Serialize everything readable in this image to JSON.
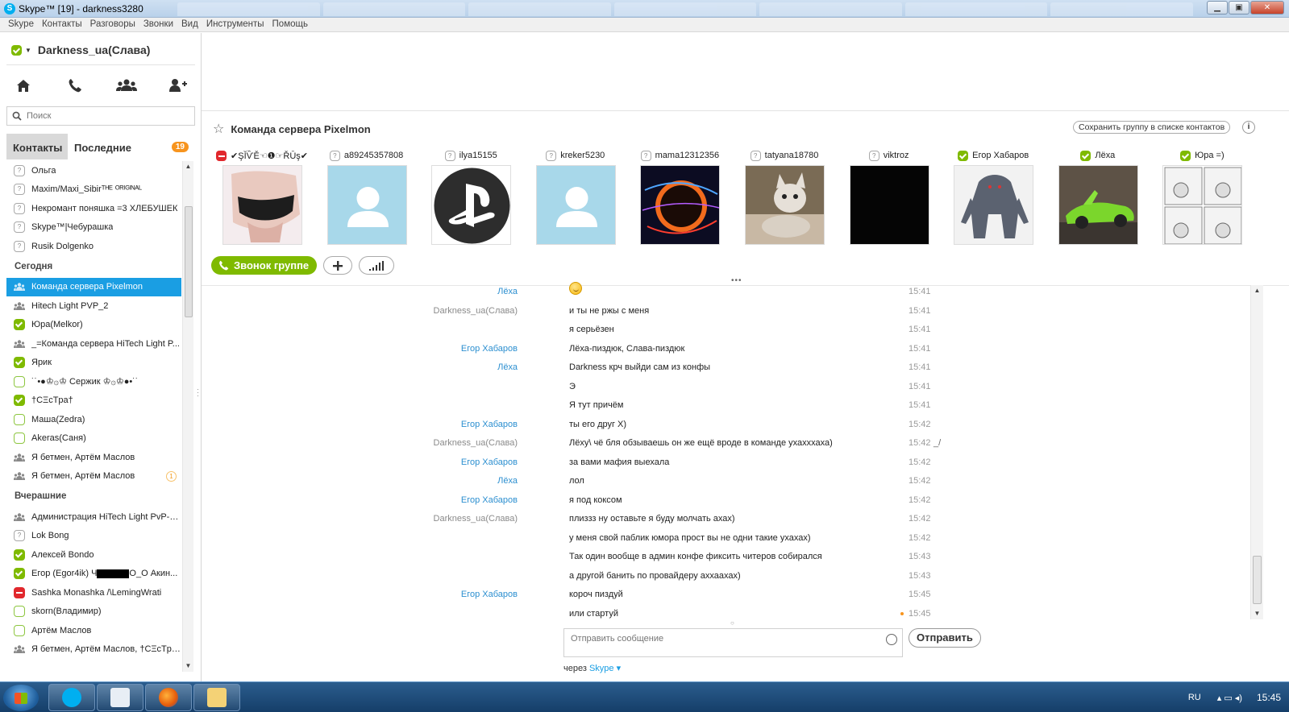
{
  "window": {
    "title": "Skype™ [19] - darkness3280",
    "minimize": "▁",
    "maximize": "▣",
    "close": "✕"
  },
  "menu": [
    "Skype",
    "Контакты",
    "Разговоры",
    "Звонки",
    "Вид",
    "Инструменты",
    "Помощь"
  ],
  "profile": {
    "name": "Darkness_ua(Слава)",
    "status": "online"
  },
  "nav_icons": [
    "home-icon",
    "phone-icon",
    "contacts-icon",
    "add-contact-icon"
  ],
  "search": {
    "placeholder": "Поиск",
    "value": ""
  },
  "tabs": {
    "contacts": "Контакты",
    "recent": "Последние",
    "recent_badge": "19"
  },
  "contacts_top": [
    {
      "name": "Ольга",
      "status": "unknown"
    },
    {
      "name": "Maxim/Maxi_Sibirᵀᴴᴱ ᴼᴿᴵᴳᴵᴺᴬᴸ",
      "status": "unknown"
    },
    {
      "name": "Некромант поняшка =3 ХЛЕБУШЕК",
      "status": "unknown"
    },
    {
      "name": "Skype™|Чебурашка",
      "status": "unknown"
    },
    {
      "name": "Rusik Dolgenko",
      "status": "unknown"
    }
  ],
  "section_today": "Сегодня",
  "contacts_today": [
    {
      "name": "Команда сервера Pixelmon",
      "status": "group",
      "selected": true
    },
    {
      "name": "Hitech Light PVP_2",
      "status": "group"
    },
    {
      "name": "Юра(Melkor)",
      "status": "online"
    },
    {
      "name": "_=Команда сервера HiTech Light P...",
      "status": "group"
    },
    {
      "name": "Ярик",
      "status": "online"
    },
    {
      "name": "˙˙•●♔۞♔ Сержик ♔۞♔●•˙˙",
      "status": "offline"
    },
    {
      "name": "†CΞcTpa†",
      "status": "online"
    },
    {
      "name": "Маша(Zedra)",
      "status": "offline"
    },
    {
      "name": "Akeras(Саня)",
      "status": "offline"
    },
    {
      "name": "Я бетмен, Артём Маслов",
      "status": "group"
    },
    {
      "name": "Я бетмен, Артём Маслов",
      "status": "group",
      "badge": "1"
    }
  ],
  "section_yesterday": "Вчерашние",
  "contacts_yesterday": [
    {
      "name": "Администрация HiTech Light PvP-P...",
      "status": "group"
    },
    {
      "name": "Lok Bong",
      "status": "unknown"
    },
    {
      "name": "Алексей Bondo",
      "status": "online"
    },
    {
      "name": "Егор  (Egor4ik) Ч",
      "suffix": "O_O Акин...",
      "status": "online",
      "redacted": true
    },
    {
      "name": "Sashka Monashka /\\LemingWrati",
      "status": "dnd"
    },
    {
      "name": "skorn(Владимир)",
      "status": "offline"
    },
    {
      "name": "Артём Маслов",
      "status": "offline"
    },
    {
      "name": "Я бетмен, Артём Маслов, †CΞcTpa†",
      "status": "group"
    }
  ],
  "chat": {
    "title": "Команда сервера Pixelmon",
    "save_group": "Сохранить группу в списке контактов",
    "info": "i",
    "call_group": "Звонок группе"
  },
  "members": [
    {
      "name": "✔ŞĬѶĚ☜❶☞ŘŪş✔",
      "status": "dnd",
      "avatar": "photo-pink"
    },
    {
      "name": "a89245357808",
      "status": "unknown",
      "avatar": "default"
    },
    {
      "name": "ilya15155",
      "status": "unknown",
      "avatar": "playstation"
    },
    {
      "name": "kreker5230",
      "status": "unknown",
      "avatar": "default"
    },
    {
      "name": "mama12312356",
      "status": "unknown",
      "avatar": "planet"
    },
    {
      "name": "tatyana18780",
      "status": "unknown",
      "avatar": "cat"
    },
    {
      "name": "viktroz",
      "status": "unknown",
      "avatar": "black"
    },
    {
      "name": "Егор Хабаров",
      "status": "online",
      "avatar": "monster"
    },
    {
      "name": "Лёха",
      "status": "online",
      "avatar": "car"
    },
    {
      "name": "Юра =)",
      "status": "online",
      "avatar": "comic"
    }
  ],
  "messages": [
    {
      "who": "Лёха",
      "color": "blue",
      "text": "",
      "smiley": true,
      "time": "15:41"
    },
    {
      "who": "Darkness_ua(Слава)",
      "color": "gray",
      "text": "и ты не ржы с меня",
      "time": "15:41"
    },
    {
      "who": "",
      "color": "gray",
      "text": "я серьёзен",
      "time": "15:41"
    },
    {
      "who": "Егор Хабаров",
      "color": "blue",
      "text": "Лёха-пиздюк, Слава-пиздюк",
      "time": "15:41"
    },
    {
      "who": "Лёха",
      "color": "blue",
      "text": "Darkness крч выйди сам из конфы",
      "time": "15:41"
    },
    {
      "who": "",
      "color": "blue",
      "text": "Э",
      "time": "15:41"
    },
    {
      "who": "",
      "color": "blue",
      "text": "Я тут причём",
      "time": "15:41"
    },
    {
      "who": "Егор Хабаров",
      "color": "blue",
      "text": "ты его друг Х)",
      "time": "15:42"
    },
    {
      "who": "Darkness_ua(Слава)",
      "color": "gray",
      "text": "Лёху\\ чё бля обзываешь он же ещё вроде в команде ухахххаха)",
      "time": "15:42",
      "extra": "_/"
    },
    {
      "who": "Егор Хабаров",
      "color": "blue",
      "text": "за вами мафия выехала",
      "time": "15:42"
    },
    {
      "who": "Лёха",
      "color": "blue",
      "text": "лол",
      "time": "15:42"
    },
    {
      "who": "Егор Хабаров",
      "color": "blue",
      "text": "я под коксом",
      "time": "15:42"
    },
    {
      "who": "Darkness_ua(Слава)",
      "color": "gray",
      "text": "плиззз ну оставьте я буду молчать ахах)",
      "time": "15:42"
    },
    {
      "who": "",
      "color": "gray",
      "text": "у меня свой паблик юмора прост вы не одни такие ухахах)",
      "time": "15:42"
    },
    {
      "who": "",
      "color": "gray",
      "text": "Так один вообще в админ конфе фиксить читеров собирался",
      "time": "15:43"
    },
    {
      "who": "",
      "color": "gray",
      "text": "а другой банить по провайдеру аххаахах)",
      "time": "15:43"
    },
    {
      "who": "Егор Хабаров",
      "color": "blue",
      "text": "короч пиздуй",
      "time": "15:45"
    },
    {
      "who": "",
      "color": "blue",
      "text": "или стартуй",
      "time": "15:45",
      "pending": true
    }
  ],
  "compose": {
    "placeholder": "Отправить сообщение",
    "send": "Отправить",
    "via_prefix": "через",
    "via_app": "Skype ▾"
  },
  "taskbar": {
    "items": [
      "skype-icon",
      "cube-icon",
      "firefox-icon",
      "folder-icon"
    ],
    "lang": "RU",
    "time": "15:45"
  }
}
